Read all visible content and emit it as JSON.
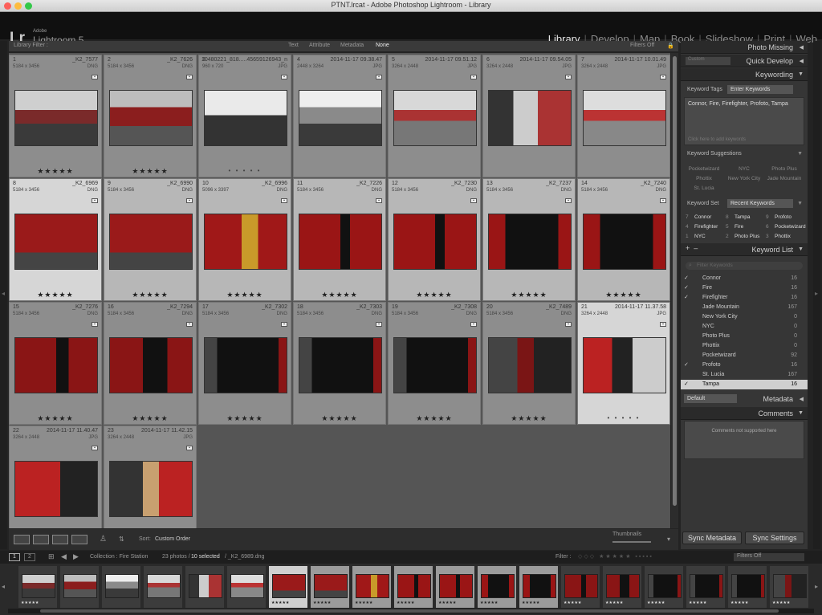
{
  "window": {
    "title": "PTNT.lrcat - Adobe Photoshop Lightroom - Library"
  },
  "identity": {
    "logo": "Lr",
    "adobe": "Adobe",
    "product": "Lightroom 5"
  },
  "modules": [
    "Library",
    "Develop",
    "Map",
    "Book",
    "Slideshow",
    "Print",
    "Web"
  ],
  "filterbar": {
    "label": "Library Filter :",
    "options": [
      "Text",
      "Attribute",
      "Metadata",
      "None"
    ],
    "filters_off": "Filters Off"
  },
  "grid": {
    "cells": [
      {
        "num": "1",
        "name": "_K2_7577",
        "dims": "5184 x 3456",
        "fmt": "DNG",
        "rating": "★★★★★",
        "state": "norm",
        "img": "a"
      },
      {
        "num": "2",
        "name": "_K2_7626",
        "dims": "5184 x 3456",
        "fmt": "DNG",
        "rating": "★★★★★",
        "state": "norm",
        "img": "b"
      },
      {
        "num": "3",
        "name": "10480221_818.....45659126943_n",
        "dims": "960 x 720",
        "fmt": "JPG",
        "rating": "• • • • •",
        "state": "norm",
        "img": "c"
      },
      {
        "num": "4",
        "name": "2014-11-17 09.38.47",
        "dims": "2448 x 3264",
        "fmt": "JPG",
        "rating": "",
        "state": "norm",
        "img": "d"
      },
      {
        "num": "5",
        "name": "2014-11-17 09.51.12",
        "dims": "3264 x 2448",
        "fmt": "JPG",
        "rating": "",
        "state": "norm",
        "img": "e"
      },
      {
        "num": "6",
        "name": "2014-11-17 09.54.05",
        "dims": "3264 x 2448",
        "fmt": "JPG",
        "rating": "",
        "state": "norm",
        "img": "f"
      },
      {
        "num": "7",
        "name": "2014-11-17 10.01.49",
        "dims": "3264 x 2448",
        "fmt": "JPG",
        "rating": "",
        "state": "norm",
        "img": "g"
      },
      {
        "num": "8",
        "name": "_K2_6969",
        "dims": "5184 x 3456",
        "fmt": "DNG",
        "rating": "★★★★★",
        "state": "hi",
        "img": "h"
      },
      {
        "num": "9",
        "name": "_K2_6990",
        "dims": "5184 x 3456",
        "fmt": "DNG",
        "rating": "★★★★★",
        "state": "sel",
        "img": "h"
      },
      {
        "num": "10",
        "name": "_K2_6996",
        "dims": "5096 x 3397",
        "fmt": "DNG",
        "rating": "★★★★★",
        "state": "sel",
        "img": "i"
      },
      {
        "num": "11",
        "name": "_K2_7226",
        "dims": "5184 x 3456",
        "fmt": "DNG",
        "rating": "★★★★★",
        "state": "sel",
        "img": "j"
      },
      {
        "num": "12",
        "name": "_K2_7230",
        "dims": "5184 x 3456",
        "fmt": "DNG",
        "rating": "★★★★★",
        "state": "sel",
        "img": "j"
      },
      {
        "num": "13",
        "name": "_K2_7237",
        "dims": "5184 x 3456",
        "fmt": "DNG",
        "rating": "★★★★★",
        "state": "sel",
        "img": "k"
      },
      {
        "num": "14",
        "name": "_K2_7240",
        "dims": "5184 x 3456",
        "fmt": "DNG",
        "rating": "★★★★★",
        "state": "sel",
        "img": "k"
      },
      {
        "num": "15",
        "name": "_K2_7276",
        "dims": "5184 x 3456",
        "fmt": "DNG",
        "rating": "★★★★★",
        "state": "norm",
        "img": "l"
      },
      {
        "num": "16",
        "name": "_K2_7294",
        "dims": "5184 x 3456",
        "fmt": "DNG",
        "rating": "★★★★★",
        "state": "norm",
        "img": "m"
      },
      {
        "num": "17",
        "name": "_K2_7302",
        "dims": "5184 x 3456",
        "fmt": "DNG",
        "rating": "★★★★★",
        "state": "norm",
        "img": "n"
      },
      {
        "num": "18",
        "name": "_K2_7303",
        "dims": "5184 x 3456",
        "fmt": "DNG",
        "rating": "★★★★★",
        "state": "norm",
        "img": "n"
      },
      {
        "num": "19",
        "name": "_K2_7308",
        "dims": "5184 x 3456",
        "fmt": "DNG",
        "rating": "★★★★★",
        "state": "norm",
        "img": "n"
      },
      {
        "num": "20",
        "name": "_K2_7489",
        "dims": "5184 x 3456",
        "fmt": "DNG",
        "rating": "★★★★★",
        "state": "norm",
        "img": "o"
      },
      {
        "num": "21",
        "name": "2014-11-17 11.37.58",
        "dims": "3264 x 2448",
        "fmt": "JPG",
        "rating": "• • • • •",
        "state": "hi",
        "img": "p"
      },
      {
        "num": "22",
        "name": "2014-11-17 11.40.47",
        "dims": "3264 x 2448",
        "fmt": "JPG",
        "rating": "",
        "state": "norm",
        "img": "q"
      },
      {
        "num": "23",
        "name": "2014-11-17 11.42.15",
        "dims": "3264 x 2448",
        "fmt": "JPG",
        "rating": "",
        "state": "norm",
        "img": "r"
      }
    ]
  },
  "toolbar": {
    "sort_label": "Sort:",
    "sort_value": "Custom Order",
    "thumbs_label": "Thumbnails"
  },
  "right_panel": {
    "photo_missing": "Photo Missing",
    "quick_develop": "Quick Develop",
    "quick_develop_sel": "Custom",
    "keywording": "Keywording",
    "keyword_tags_label": "Keyword Tags",
    "keyword_tags_mode": "Enter Keywords",
    "keyword_tags_value": "Connor, Fire, Firefighter, Profoto, Tampa",
    "keyword_tags_placeholder": "Click here to add keywords",
    "suggestions_label": "Keyword Suggestions",
    "suggestions": [
      "Pocketwizard",
      "NYC",
      "Photo Plus",
      "Phottix",
      "New York City",
      "Jade Mountain",
      "St. Lucia"
    ],
    "keyword_set_label": "Keyword Set",
    "keyword_set_value": "Recent Keywords",
    "keyword_set": [
      {
        "n": "7",
        "k": "Connor"
      },
      {
        "n": "8",
        "k": "Tampa"
      },
      {
        "n": "9",
        "k": "Profoto"
      },
      {
        "n": "4",
        "k": "Firefighter"
      },
      {
        "n": "5",
        "k": "Fire"
      },
      {
        "n": "6",
        "k": "Pocketwizard"
      },
      {
        "n": "1",
        "k": "NYC"
      },
      {
        "n": "2",
        "k": "Photo Plus"
      },
      {
        "n": "3",
        "k": "Phottix"
      }
    ],
    "keyword_list_title": "Keyword List",
    "keyword_list_search": "Filter Keywords",
    "keyword_list": [
      {
        "check": "✓",
        "name": "Connor",
        "count": "16"
      },
      {
        "check": "✓",
        "name": "Fire",
        "count": "16"
      },
      {
        "check": "✓",
        "name": "Firefighter",
        "count": "16"
      },
      {
        "check": "",
        "name": "Jade Mountain",
        "count": "167"
      },
      {
        "check": "",
        "name": "New York City",
        "count": "0"
      },
      {
        "check": "",
        "name": "NYC",
        "count": "0"
      },
      {
        "check": "",
        "name": "Photo Plus",
        "count": "0"
      },
      {
        "check": "",
        "name": "Phottix",
        "count": "0"
      },
      {
        "check": "",
        "name": "Pocketwizard",
        "count": "92"
      },
      {
        "check": "✓",
        "name": "Profoto",
        "count": "16"
      },
      {
        "check": "",
        "name": "St. Lucia",
        "count": "167"
      },
      {
        "check": "✓",
        "name": "Tampa",
        "count": "16",
        "selected": true
      }
    ],
    "metadata_sel": "Default",
    "metadata": "Metadata",
    "comments": "Comments",
    "comments_msg": "Comments not supported here",
    "sync_metadata": "Sync Metadata",
    "sync_settings": "Sync Settings"
  },
  "filmstrip_bar": {
    "collection": "Collection : Fire Station",
    "count_pre": "23 photos /",
    "selected": "10 selected",
    "current": "/ _K2_6989.dng",
    "filter_label": "Filter :",
    "filters_off": "Filters Off",
    "page1": "1",
    "page2": "2"
  },
  "colors": {
    "accent": "#e8e8e8",
    "panel": "#363636",
    "grid_bg": "#555555",
    "cell": "#8d8d8d",
    "cell_selected": "#b7b7b7",
    "cell_active": "#d6d6d6"
  },
  "filmstrip": [
    {
      "img": "a",
      "state": "norm",
      "stars": "★★★★★"
    },
    {
      "img": "b",
      "state": "norm",
      "stars": ""
    },
    {
      "img": "d",
      "state": "norm",
      "stars": ""
    },
    {
      "img": "e",
      "state": "norm",
      "stars": ""
    },
    {
      "img": "f",
      "state": "norm",
      "stars": ""
    },
    {
      "img": "g",
      "state": "norm",
      "stars": ""
    },
    {
      "img": "h",
      "state": "hi",
      "stars": "★★★★★"
    },
    {
      "img": "h",
      "state": "sel",
      "stars": "★★★★★"
    },
    {
      "img": "i",
      "state": "sel",
      "stars": "★★★★★"
    },
    {
      "img": "j",
      "state": "sel",
      "stars": "★★★★★"
    },
    {
      "img": "j",
      "state": "sel",
      "stars": "★★★★★"
    },
    {
      "img": "k",
      "state": "sel",
      "stars": "★★★★★"
    },
    {
      "img": "k",
      "state": "sel",
      "stars": "★★★★★"
    },
    {
      "img": "l",
      "state": "norm",
      "stars": "★★★★★"
    },
    {
      "img": "m",
      "state": "norm",
      "stars": "★★★★★"
    },
    {
      "img": "n",
      "state": "norm",
      "stars": "★★★★★"
    },
    {
      "img": "n",
      "state": "norm",
      "stars": "★★★★★"
    },
    {
      "img": "n",
      "state": "norm",
      "stars": "★★★★★"
    },
    {
      "img": "o",
      "state": "norm",
      "stars": "★★★★★"
    }
  ]
}
